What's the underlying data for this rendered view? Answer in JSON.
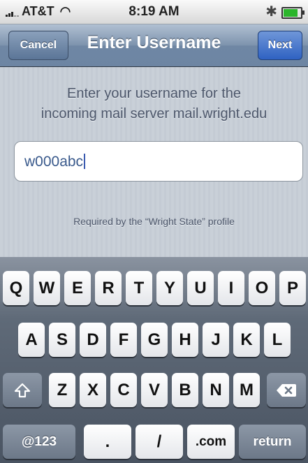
{
  "status_bar": {
    "carrier": "AT&T",
    "time": "8:19 AM"
  },
  "nav": {
    "title": "Enter Username",
    "cancel_label": "Cancel",
    "next_label": "Next"
  },
  "content": {
    "prompt_line1": "Enter your username for the",
    "prompt_line2": "incoming mail server mail.wright.edu",
    "username_value": "w000abc",
    "note": "Required by the “Wright State” profile"
  },
  "keyboard": {
    "row1": [
      "Q",
      "W",
      "E",
      "R",
      "T",
      "Y",
      "U",
      "I",
      "O",
      "P"
    ],
    "row2": [
      "A",
      "S",
      "D",
      "F",
      "G",
      "H",
      "J",
      "K",
      "L"
    ],
    "row3": [
      "Z",
      "X",
      "C",
      "V",
      "B",
      "N",
      "M"
    ],
    "numbers_key": "@123",
    "period_key": ".",
    "slash_key": "/",
    "com_key": ".com",
    "return_key": "return"
  },
  "colors": {
    "nav_blue": "#6f87a4",
    "next_blue": "#2f62c2",
    "input_text": "#3a5a8c"
  }
}
